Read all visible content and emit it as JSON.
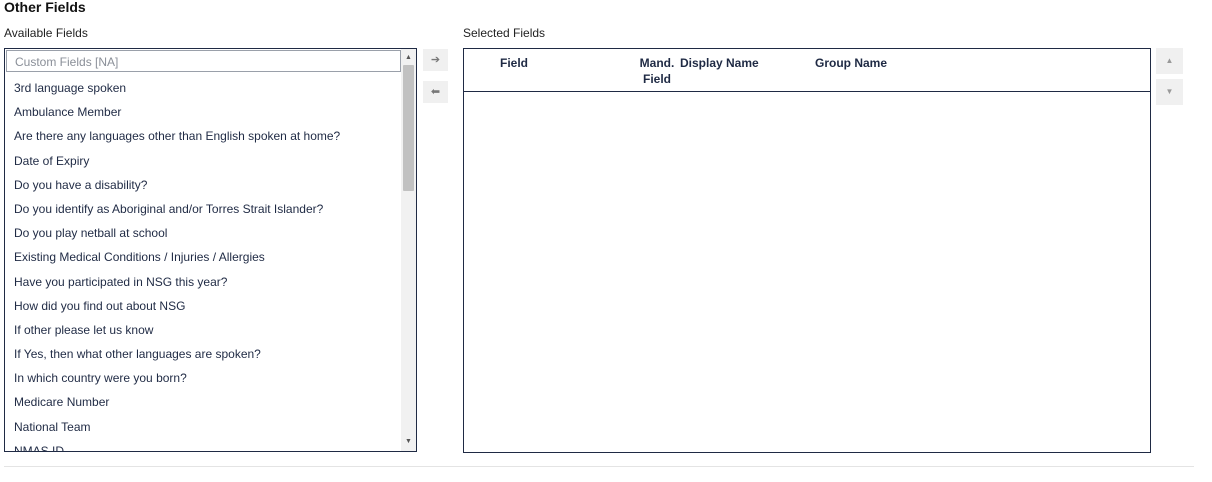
{
  "section": {
    "title": "Other Fields"
  },
  "available": {
    "label": "Available Fields",
    "group_header": "Custom Fields [NA]",
    "items": [
      "3rd language spoken",
      "Ambulance Member",
      "Are there any languages other than English spoken at home?",
      "Date of Expiry",
      "Do you have a disability?",
      "Do you identify as Aboriginal and/or Torres Strait Islander?",
      "Do you play netball at school",
      "Existing Medical Conditions / Injuries / Allergies",
      "Have you participated in NSG this year?",
      "How did you find out about NSG",
      "If other please let us know",
      "If Yes, then what other languages are spoken?",
      "In which country were you born?",
      "Medicare Number",
      "National Team",
      "NMAS ID"
    ]
  },
  "move_buttons": {
    "add_icon": "arrow-right-icon",
    "remove_icon": "arrow-left-icon"
  },
  "selected": {
    "label": "Selected Fields",
    "columns": {
      "field": "Field",
      "mandatory": "Mand. Field",
      "display_name": "Display Name",
      "group_name": "Group Name"
    }
  },
  "order_buttons": {
    "up_icon": "triangle-up-icon",
    "down_icon": "triangle-down-icon"
  }
}
